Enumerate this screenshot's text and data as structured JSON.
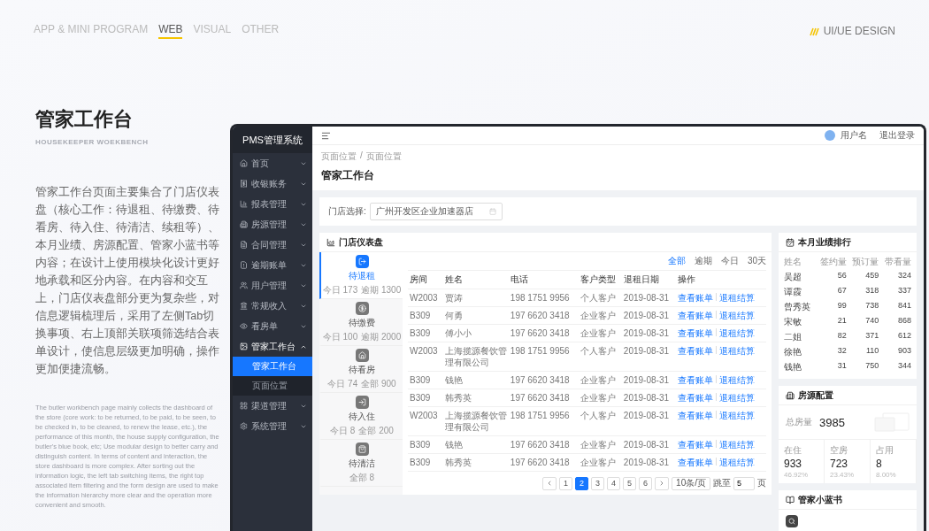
{
  "nav": {
    "items": [
      {
        "label": "APP & MINI PROGRAM",
        "selected": false
      },
      {
        "label": "WEB",
        "selected": true
      },
      {
        "label": "VISUAL",
        "selected": false
      },
      {
        "label": "OTHER",
        "selected": false
      }
    ],
    "brand": "UI/UE DESIGN"
  },
  "intro": {
    "title": "管家工作台",
    "subtitle": "HOUSEKEEPER WOEKBENCH",
    "body": "管家工作台页面主要集合了门店仪表盘（核心工作：待退租、待缴费、待看房、待入住、待清洁、续租等）、本月业绩、房源配置、管家小蓝书等内容；在设计上使用模块化设计更好地承载和区分内容。在内容和交互上，门店仪表盘部分更为复杂些，对信息逻辑梳理后，采用了左侧Tab切换事项、右上顶部关联项筛选结合表单设计，使信息层级更加明确，操作更加便捷流畅。",
    "body_en": "The butler workbench page mainly collects the dashboard of the store (core work: to be returned, to be paid, to be seen, to be checked in, to be cleaned, to renew the lease, etc.), the performance of this month, the house supply configuration, the butler's blue book, etc; Use modular design to better carry and distinguish content. In terms of content and interaction, the store dashboard is more complex. After sorting out the information logic, the left tab switching items, the right top associated item filtering and the form design are used to make the information hierarchy more clear and the operation more convenient and smooth."
  },
  "app": {
    "logo": "PMS管理系统",
    "sidebar": {
      "items": [
        {
          "label": "首页",
          "expanded": false
        },
        {
          "label": "收银账务",
          "expanded": false
        },
        {
          "label": "报表管理",
          "expanded": false
        },
        {
          "label": "房源管理",
          "expanded": false
        },
        {
          "label": "合同管理",
          "expanded": false
        },
        {
          "label": "逾期账单",
          "expanded": false
        },
        {
          "label": "用户管理",
          "expanded": false
        },
        {
          "label": "常规收入",
          "expanded": false
        },
        {
          "label": "看房单",
          "expanded": false
        },
        {
          "label": "管家工作台",
          "expanded": true,
          "children": [
            {
              "label": "管家工作台",
              "selected": true
            },
            {
              "label": "页面位置",
              "selected": false
            }
          ]
        },
        {
          "label": "渠道管理",
          "expanded": false
        },
        {
          "label": "系统管理",
          "expanded": false
        }
      ]
    },
    "header": {
      "user": "用户名",
      "logout": "退出登录"
    },
    "breadcrumb": [
      "页面位置",
      "页面位置"
    ],
    "breadcrumb_separator": "/",
    "page_title": "管家工作台",
    "store_filter": {
      "label": "门店选择:",
      "value": "广州开发区企业加速器店"
    },
    "dashboard": {
      "title": "门店仪表盘",
      "tabs": [
        {
          "label": "待退租",
          "selected": true,
          "stats": [
            "今日 173",
            "逾期 1300"
          ]
        },
        {
          "label": "待缴费",
          "selected": false,
          "stats": [
            "今日 100",
            "逾期 2000"
          ]
        },
        {
          "label": "待看房",
          "selected": false,
          "stats": [
            "今日 74",
            "全部 900"
          ]
        },
        {
          "label": "待入住",
          "selected": false,
          "stats": [
            "今日 8",
            "全部 200"
          ]
        },
        {
          "label": "待清洁",
          "selected": false,
          "stats": [
            "全部 8"
          ]
        }
      ],
      "filters": [
        {
          "label": "全部",
          "selected": true
        },
        {
          "label": "逾期",
          "selected": false
        },
        {
          "label": "今日",
          "selected": false
        },
        {
          "label": "30天",
          "selected": false
        }
      ],
      "table": {
        "columns": [
          "房间",
          "姓名",
          "电话",
          "客户类型",
          "退租日期",
          "操作"
        ],
        "rows": [
          {
            "cells": [
              "W2003",
              "贾涛",
              "198 1751 9956",
              "个人客户",
              "2019-08-31"
            ],
            "actions": [
              "查看账单",
              "退租结算"
            ]
          },
          {
            "cells": [
              "B309",
              "何勇",
              "197 6620 3418",
              "企业客户",
              "2019-08-31"
            ],
            "actions": [
              "查看账单",
              "退租结算"
            ]
          },
          {
            "cells": [
              "B309",
              "傅小小",
              "197 6620 3418",
              "企业客户",
              "2019-08-31"
            ],
            "actions": [
              "查看账单",
              "退租结算"
            ]
          },
          {
            "cells": [
              "W2003",
              "上海揽源餐饮管理有限公司",
              "198 1751 9956",
              "个人客户",
              "2019-08-31"
            ],
            "actions": [
              "查看账单",
              "退租结算"
            ]
          },
          {
            "cells": [
              "B309",
              "钱艳",
              "197 6620 3418",
              "企业客户",
              "2019-08-31"
            ],
            "actions": [
              "查看账单",
              "退租结算"
            ]
          },
          {
            "cells": [
              "B309",
              "韩秀英",
              "197 6620 3418",
              "企业客户",
              "2019-08-31"
            ],
            "actions": [
              "查看账单",
              "退租结算"
            ]
          },
          {
            "cells": [
              "W2003",
              "上海揽源餐饮管理有限公司",
              "198 1751 9956",
              "个人客户",
              "2019-08-31"
            ],
            "actions": [
              "查看账单",
              "退租结算"
            ]
          },
          {
            "cells": [
              "B309",
              "钱艳",
              "197 6620 3418",
              "企业客户",
              "2019-08-31"
            ],
            "actions": [
              "查看账单",
              "退租结算"
            ]
          },
          {
            "cells": [
              "B309",
              "韩秀英",
              "197 6620 3418",
              "企业客户",
              "2019-08-31"
            ],
            "actions": [
              "查看账单",
              "退租结算"
            ]
          }
        ]
      },
      "pagination": {
        "pages": [
          {
            "label": "1",
            "selected": false
          },
          {
            "label": "2",
            "selected": true
          },
          {
            "label": "3",
            "selected": false
          },
          {
            "label": "4",
            "selected": false
          },
          {
            "label": "5",
            "selected": false
          },
          {
            "label": "6",
            "selected": false
          }
        ],
        "page_size": "10条/页",
        "jump_label": "跳至",
        "jump_value": "5",
        "page_suffix": "页"
      }
    },
    "ranking": {
      "title": "本月业绩排行",
      "columns": [
        "姓名",
        "签约量",
        "预订量",
        "带看量"
      ],
      "rows": [
        [
          "吴超",
          "56",
          "459",
          "324"
        ],
        [
          "谭霞",
          "67",
          "318",
          "337"
        ],
        [
          "曾秀英",
          "99",
          "738",
          "841"
        ],
        [
          "宋敏",
          "21",
          "740",
          "868"
        ],
        [
          "二姐",
          "82",
          "371",
          "612"
        ],
        [
          "徐艳",
          "32",
          "110",
          "903"
        ],
        [
          "钱艳",
          "31",
          "750",
          "344"
        ]
      ]
    },
    "housing": {
      "title": "房源配置",
      "total_label": "总房量",
      "total": "3985",
      "stats": [
        {
          "label": "在住",
          "value": "933",
          "percent": "46.92%"
        },
        {
          "label": "空房",
          "value": "723",
          "percent": "23.43%"
        },
        {
          "label": "占用",
          "value": "8",
          "percent": "8.00%"
        }
      ]
    },
    "bluebook": {
      "title": "管家小蓝书"
    }
  }
}
